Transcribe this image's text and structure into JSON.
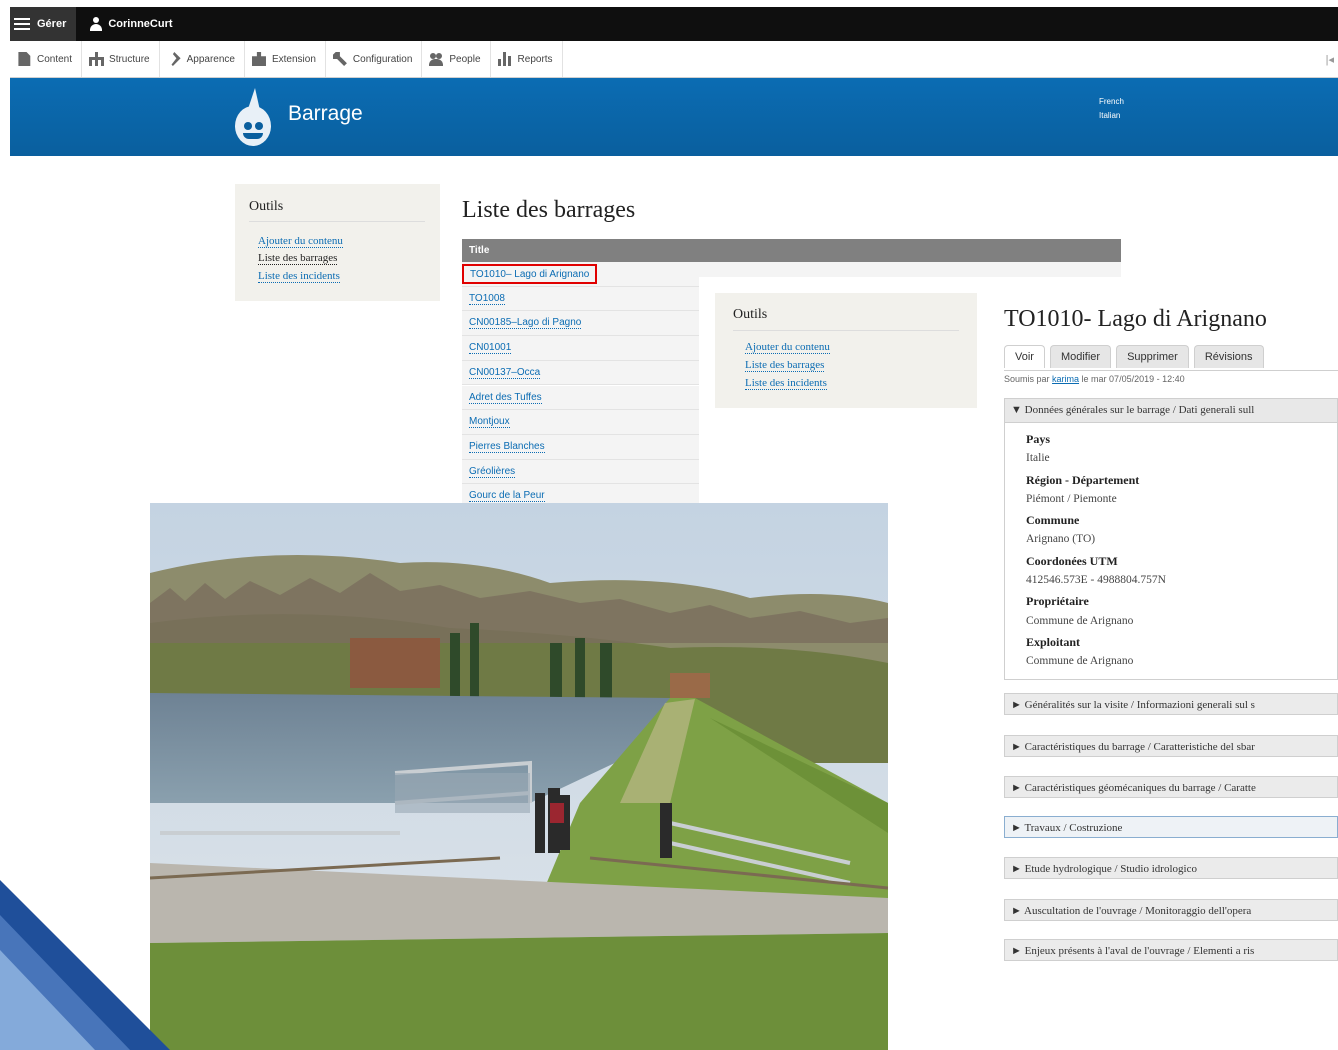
{
  "toolbar": {
    "manage_label": "Gérer",
    "user_label": "CorinneCurt"
  },
  "tray": {
    "items": [
      {
        "label": "Content",
        "icon": "page-icon"
      },
      {
        "label": "Structure",
        "icon": "structure-icon"
      },
      {
        "label": "Apparence",
        "icon": "brush-icon"
      },
      {
        "label": "Extension",
        "icon": "puzzle-icon"
      },
      {
        "label": "Configuration",
        "icon": "wrench-icon"
      },
      {
        "label": "People",
        "icon": "people-icon"
      },
      {
        "label": "Reports",
        "icon": "bar-chart-icon"
      }
    ],
    "edge_glyph": "|◂"
  },
  "header": {
    "site_name": "Barrage",
    "languages": [
      "French",
      "Italian"
    ],
    "colors": {
      "primary": "#0a5f9e"
    }
  },
  "sidebar": {
    "title": "Outils",
    "links": [
      "Ajouter du contenu",
      "Liste des barrages",
      "Liste des incidents"
    ]
  },
  "list": {
    "title": "Liste des barrages",
    "column_header": "Title",
    "rows": [
      "TO1010– Lago di Arignano",
      "TO1008",
      "CN00185–Lago di Pagno",
      "CN01001",
      "CN00137–Occa",
      "Adret des Tuffes",
      "Montjoux",
      "Pierres Blanches",
      "Gréolières",
      "Gourc de la Peur"
    ],
    "highlight_color": "#e00000"
  },
  "detail": {
    "sidebar": {
      "title": "Outils",
      "links": [
        "Ajouter du contenu",
        "Liste des barrages",
        "Liste des incidents"
      ]
    },
    "title": "TO1010- Lago di Arignano",
    "tabs": [
      "Voir",
      "Modifier",
      "Supprimer",
      "Révisions"
    ],
    "submitted": {
      "prefix": "Soumis par ",
      "author": "karima",
      "suffix": " le mar 07/05/2019 - 12:40"
    },
    "open_section": {
      "legend": "▼ Données générales sur le barrage / Dati generali sull",
      "fields": [
        {
          "label": "Pays",
          "value": "Italie"
        },
        {
          "label": "Région - Département",
          "value": "Piémont / Piemonte"
        },
        {
          "label": "Commune",
          "value": "Arignano (TO)"
        },
        {
          "label": "Coordonées UTM",
          "value": "412546.573E - 4988804.757N"
        },
        {
          "label": "Propriétaire",
          "value": "Commune de Arignano"
        },
        {
          "label": "Exploitant",
          "value": "Commune de Arignano"
        }
      ]
    },
    "collapsed_sections": [
      "► Généralités sur la visite / Informazioni generali sul s",
      "► Caractéristiques du barrage / Caratteristiche del sbar",
      "► Caractéristiques géomécaniques du barrage / Caratte",
      "► Travaux / Costruzione",
      "► Etude hydrologique / Studio idrologico",
      "► Auscultation de l'ouvrage / Monitoraggio dell'opera",
      "► Enjeux présents à l'aval de l'ouvrage / Elementi a ris"
    ]
  }
}
